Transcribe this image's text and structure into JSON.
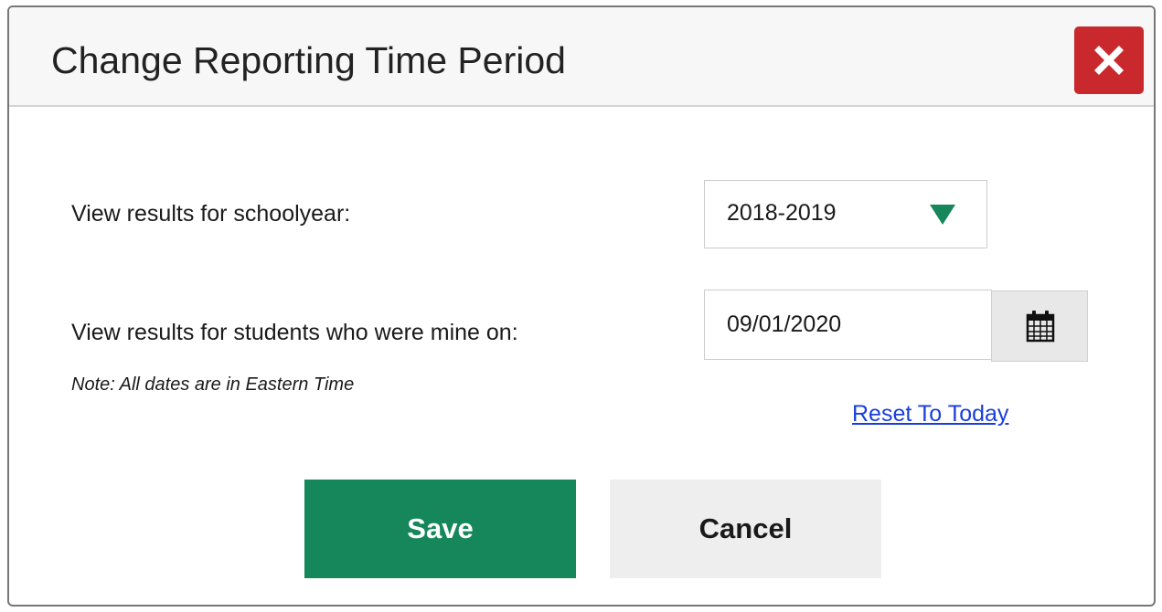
{
  "dialog": {
    "title": "Change Reporting Time Period",
    "close_icon": "close-x-icon",
    "close_color": "#c9282d"
  },
  "form": {
    "schoolyear_label": "View results for schoolyear:",
    "schoolyear_value": "2018-2019",
    "dropdown_icon": "chevron-down-icon",
    "dropdown_color": "#15875a",
    "date_label": "View results for students who were mine on:",
    "date_value": "09/01/2020",
    "calendar_icon": "calendar-icon",
    "note": "Note: All dates are in Eastern Time",
    "reset_link": "Reset To Today"
  },
  "actions": {
    "save_label": "Save",
    "save_color": "#15875a",
    "cancel_label": "Cancel"
  }
}
